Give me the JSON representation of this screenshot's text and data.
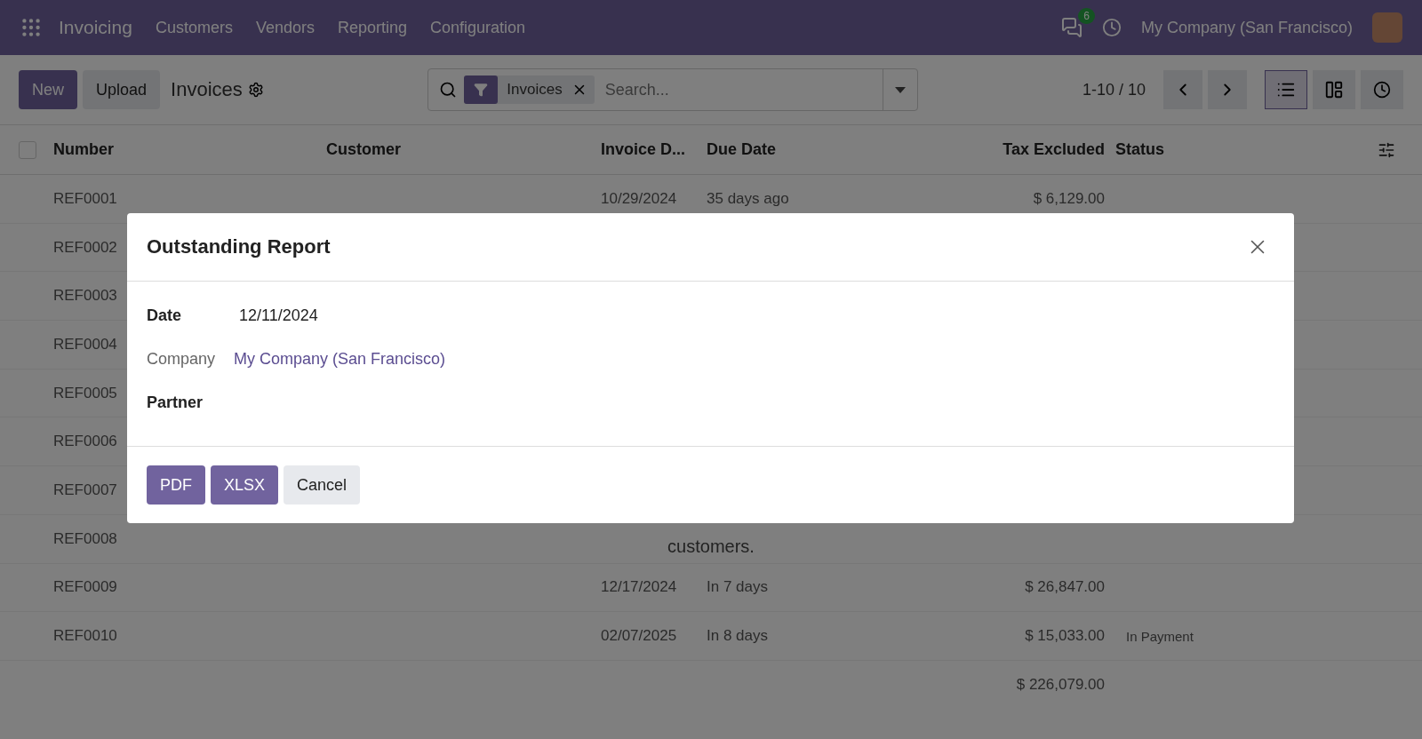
{
  "navbar": {
    "app": "Invoicing",
    "menu": [
      "Customers",
      "Vendors",
      "Reporting",
      "Configuration"
    ],
    "messages_badge": "6",
    "company": "My Company (San Francisco)"
  },
  "control_panel": {
    "buttons": [
      "New",
      "Upload"
    ],
    "breadcrumb": "Invoices",
    "facet": "Invoices",
    "search_placeholder": "Search...",
    "pager": "1-10 / 10",
    "views": [
      {
        "kind": "list",
        "selected": true
      },
      {
        "kind": "kanban",
        "selected": false
      },
      {
        "kind": "activity",
        "selected": false
      }
    ]
  },
  "table": {
    "select_all": {
      "checked": false
    },
    "columns": [
      "Number",
      "Customer",
      "Invoice D...",
      "Due Date",
      "Tax Excluded",
      "Status"
    ],
    "rows": [
      {
        "number": "REF0001",
        "date": "10/29/2024",
        "due": "35 days ago",
        "amount": "$ 6,129.00"
      },
      {
        "number": "REF0002"
      },
      {
        "number": "REF0003"
      },
      {
        "number": "REF0004"
      },
      {
        "number": "REF0005"
      },
      {
        "number": "REF0006"
      },
      {
        "number": "REF0007"
      },
      {
        "number": "REF0008"
      },
      {
        "number": "REF0009",
        "date": "12/17/2024",
        "due": "In 7 days",
        "amount": "$ 26,847.00"
      },
      {
        "number": "REF0010",
        "date": "02/07/2025",
        "due": "In 8 days",
        "amount": "$ 15,033.00",
        "status": "In Payment"
      }
    ],
    "total": "$ 226,079.00"
  },
  "help_text": "customers.",
  "dialog": {
    "title": "Outstanding Report",
    "fields": [
      {
        "label": "Date",
        "value": "12/11/2024",
        "kind": "date"
      },
      {
        "label": "Company",
        "value": "My Company (San Francisco)",
        "kind": "link"
      },
      {
        "label": "Partner",
        "kind": "empty"
      }
    ],
    "buttons": [
      {
        "label": "PDF",
        "kind": "primary"
      },
      {
        "label": "XLSX",
        "kind": "primary"
      },
      {
        "label": "Cancel",
        "kind": "secondary"
      }
    ]
  }
}
